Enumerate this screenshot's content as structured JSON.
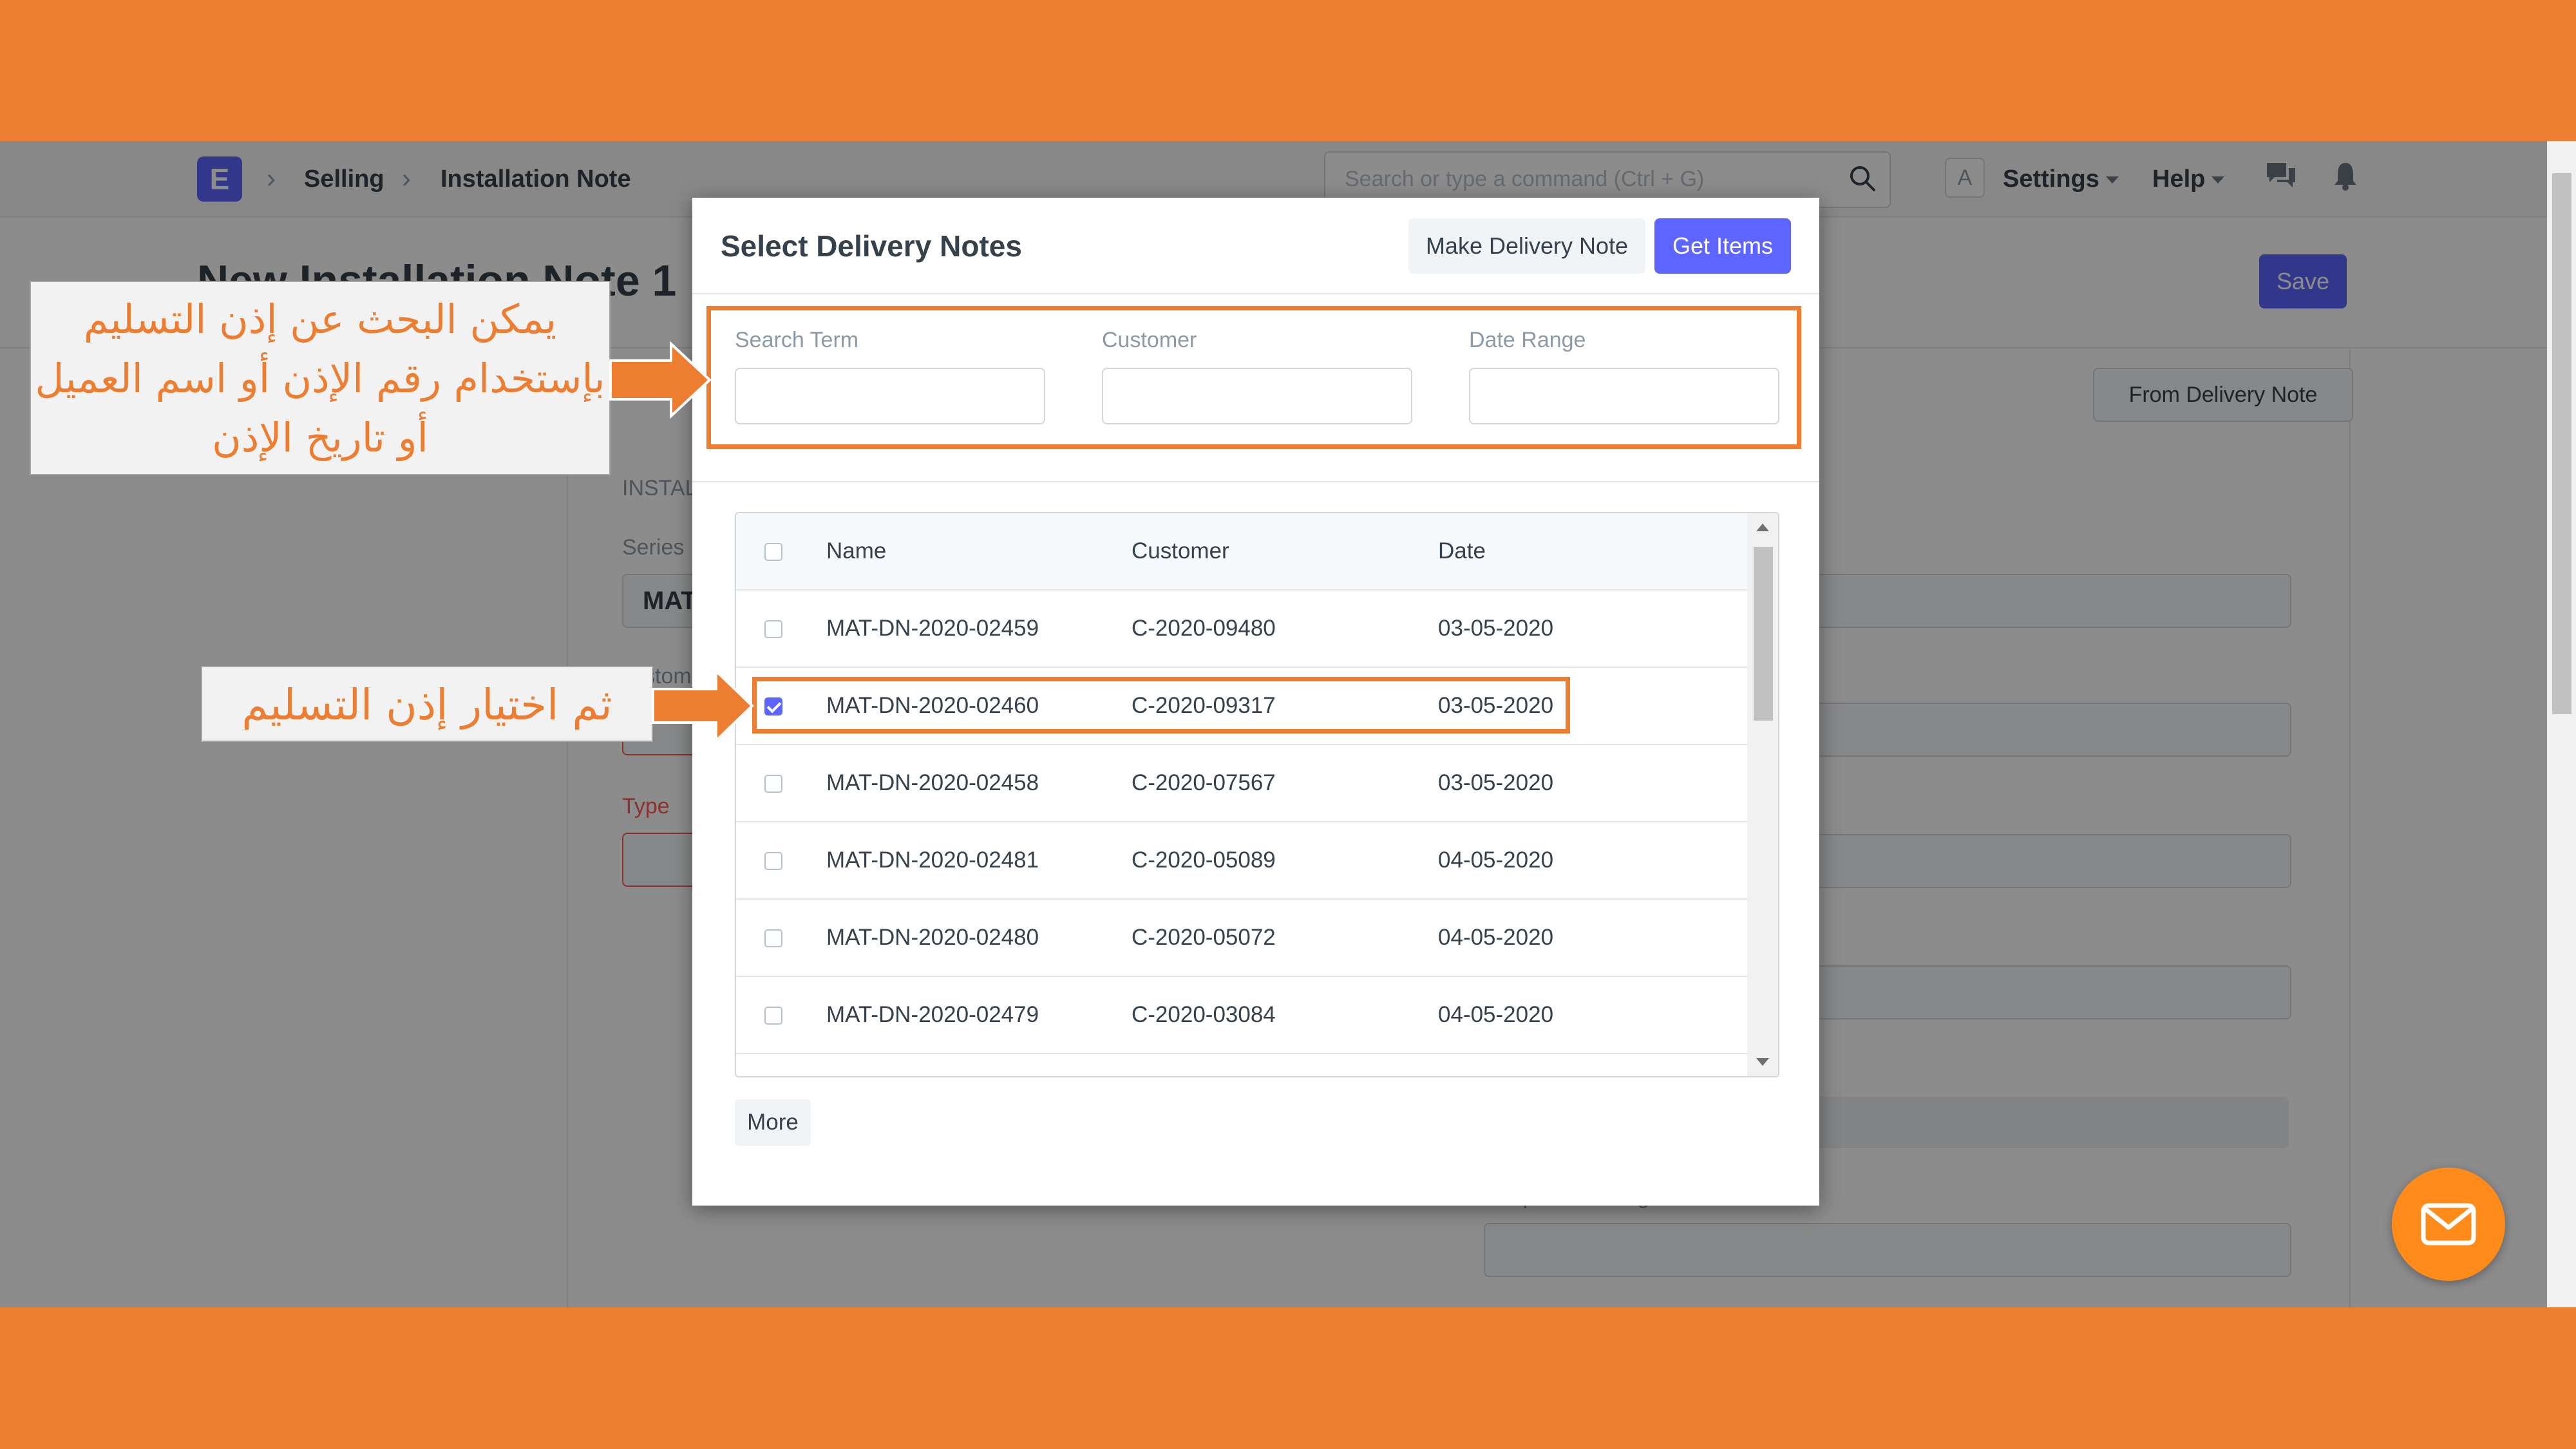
{
  "navbar": {
    "logo_letter": "E",
    "breadcrumbs": [
      "Selling",
      "Installation Note"
    ],
    "search_placeholder": "Search or type a command (Ctrl + G)",
    "avatar_letter": "A",
    "settings_label": "Settings",
    "help_label": "Help"
  },
  "page": {
    "title": "New Installation Note 1",
    "save_label": "Save",
    "from_delivery_note_label": "From Delivery Note",
    "section_label": "INSTAL",
    "series_label": "Series",
    "series_value": "MAT",
    "customer_label": "stom",
    "type_label": "Type",
    "engineer_label": "Responsible Engineer"
  },
  "modal": {
    "title": "Select Delivery Notes",
    "make_button": "Make Delivery Note",
    "get_items_button": "Get Items",
    "filters": [
      {
        "label": "Search Term",
        "value": ""
      },
      {
        "label": "Customer",
        "value": ""
      },
      {
        "label": "Date Range",
        "value": ""
      }
    ],
    "columns": [
      "Name",
      "Customer",
      "Date"
    ],
    "rows": [
      {
        "name": "MAT-DN-2020-02459",
        "customer": "C-2020-09480",
        "date": "03-05-2020",
        "checked": false
      },
      {
        "name": "MAT-DN-2020-02460",
        "customer": "C-2020-09317",
        "date": "03-05-2020",
        "checked": true
      },
      {
        "name": "MAT-DN-2020-02458",
        "customer": "C-2020-07567",
        "date": "03-05-2020",
        "checked": false
      },
      {
        "name": "MAT-DN-2020-02481",
        "customer": "C-2020-05089",
        "date": "04-05-2020",
        "checked": false
      },
      {
        "name": "MAT-DN-2020-02480",
        "customer": "C-2020-05072",
        "date": "04-05-2020",
        "checked": false
      },
      {
        "name": "MAT-DN-2020-02479",
        "customer": "C-2020-03084",
        "date": "04-05-2020",
        "checked": false
      }
    ],
    "more_label": "More"
  },
  "callouts": {
    "search_hint": "يمكن البحث عن إذن التسليم بإستخدام رقم الإذن أو اسم العميل أو تاريخ الإذن",
    "select_hint": "ثم اختيار إذن التسليم"
  },
  "colors": {
    "accent": "#ed7d31",
    "primary": "#5e64ff"
  },
  "icons": [
    "search-icon",
    "chat-icon",
    "bell-icon",
    "mail-icon",
    "chevron-right-icon",
    "caret-down-icon"
  ]
}
